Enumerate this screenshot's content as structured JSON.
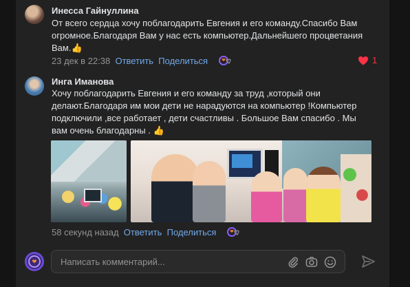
{
  "comments": [
    {
      "author": "Инесса Гайнуллина",
      "text_lines": [
        "От всего сердца хочу поблагодарить Евгения и его команду.Спасибо Вам",
        "огромное.Благодаря Вам у нас есть компьютер.Дальнейшего процветания",
        "Вам."
      ],
      "emoji": "👍",
      "time": "23 дек в 22:38",
      "reply": "Ответить",
      "share": "Поделиться",
      "likes": "1"
    },
    {
      "author": "Инга Иманова",
      "text_lines": [
        "Хочу поблагодарить Евгения и его команду за труд ,который они",
        "делают.Благодаря им мои дети не нарадуются на компьютер !Компьютер",
        "подключили ,все работает , дети счастливы . Большое Вам спасибо . Мы",
        "вам очень благодарны . "
      ],
      "emoji": "👍",
      "time": "58 секунд назад",
      "reply": "Ответить",
      "share": "Поделиться"
    }
  ],
  "composer": {
    "placeholder": "Написать комментарий..."
  },
  "colors": {
    "link": "#71aaeb",
    "like": "#ff3347",
    "bg": "#222222"
  },
  "icons": [
    "reaction-icon",
    "heart-icon",
    "attach-icon",
    "camera-icon",
    "emoji-icon",
    "send-icon"
  ]
}
